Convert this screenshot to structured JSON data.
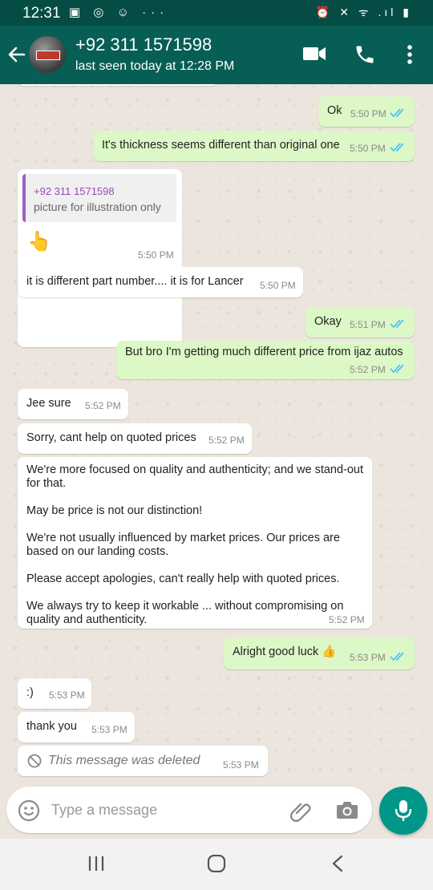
{
  "statusbar": {
    "time": "12:31",
    "left_icons": "▣ ◎ ☺ ···",
    "right_icons": "⏰ ✕ ᯤ .ıl ▮"
  },
  "header": {
    "contact": "+92 311 1571598",
    "last_seen": "last seen today at 12:28 PM"
  },
  "messages": [
    {
      "dir": "out",
      "text": "Ok",
      "time": "5:50 PM",
      "ticks": "read"
    },
    {
      "dir": "out",
      "text": "It's thickness seems different than original one",
      "time": "5:50 PM",
      "ticks": "read"
    },
    {
      "dir": "in",
      "quote_name": "+92 311 1571598",
      "quote_text": "picture for illustration only",
      "text": "👆",
      "time": "5:50 PM"
    },
    {
      "dir": "in",
      "text": "it is different part number.... it is for Lancer",
      "time": "5:50 PM"
    },
    {
      "dir": "out",
      "text": "Okay",
      "time": "5:51 PM",
      "ticks": "read"
    },
    {
      "dir": "out",
      "text": "But bro I'm getting much different price from ijaz autos",
      "time": "5:52 PM",
      "ticks": "read"
    },
    {
      "dir": "in",
      "text": "Jee sure",
      "time": "5:52 PM"
    },
    {
      "dir": "in",
      "text": "Sorry, cant help on quoted prices",
      "time": "5:52 PM"
    },
    {
      "dir": "in",
      "text": "We're more focused on quality and authenticity; and we stand-out\nfor that.\n\nMay be price is not our distinction!\n\nWe're not usually influenced by market prices. Our prices are\nbased on our landing costs.\n\nPlease accept apologies, can't really help with quoted prices.\n\nWe always try to keep it workable ... without compromising on\nquality and authenticity.",
      "time": "5:52 PM"
    },
    {
      "dir": "out",
      "text": "Alright good luck 👍",
      "time": "5:53 PM",
      "ticks": "read"
    },
    {
      "dir": "in",
      "text": ":)",
      "time": "5:53 PM"
    },
    {
      "dir": "in",
      "text": "thank you",
      "time": "5:53 PM"
    },
    {
      "dir": "in",
      "text": "This message was deleted",
      "time": "5:53 PM",
      "deleted": true
    }
  ],
  "composer": {
    "placeholder": "Type a message"
  },
  "colors": {
    "header": "#075e54",
    "statusbar": "#054d44",
    "outgoing_bubble": "#dcf8c6",
    "incoming_bubble": "#ffffff",
    "read_ticks": "#4fc3f7",
    "mic_button": "#009688"
  },
  "icons": [
    "back-arrow-icon",
    "video-call-icon",
    "phone-icon",
    "more-options-icon",
    "emoji-icon",
    "attach-icon",
    "camera-icon",
    "mic-icon",
    "blocked-icon"
  ]
}
